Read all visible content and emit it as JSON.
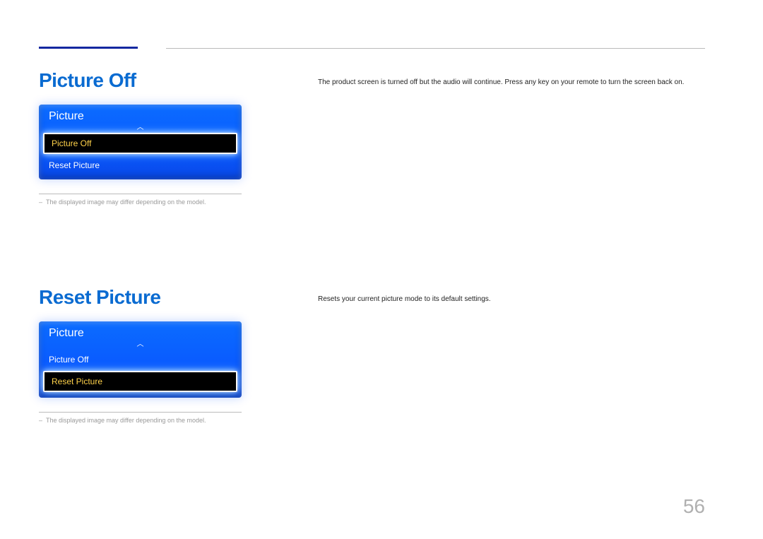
{
  "page_number": "56",
  "section1": {
    "heading": "Picture Off",
    "body": "The product screen is turned off but the audio will continue. Press any key on your remote to turn the screen back on.",
    "menu": {
      "title": "Picture",
      "items": [
        {
          "label": "Picture Off",
          "selected": true
        },
        {
          "label": "Reset Picture",
          "selected": false
        }
      ]
    },
    "footnote": "The displayed image may differ depending on the model."
  },
  "section2": {
    "heading": "Reset Picture",
    "body": "Resets your current picture mode to its default settings.",
    "menu": {
      "title": "Picture",
      "items": [
        {
          "label": "Picture Off",
          "selected": false
        },
        {
          "label": "Reset Picture",
          "selected": true
        }
      ]
    },
    "footnote": "The displayed image may differ depending on the model."
  }
}
